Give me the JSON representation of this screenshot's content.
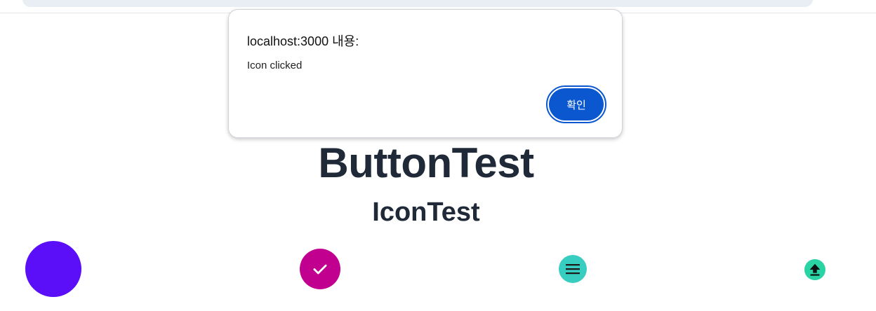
{
  "page": {
    "title": "ButtonTest",
    "subtitle": "IconTest"
  },
  "icons": [
    {
      "name": "plain-circle",
      "color": "#5b0ff9"
    },
    {
      "name": "check-icon",
      "color": "#c2008f"
    },
    {
      "name": "menu-icon",
      "color": "#37cdc1"
    },
    {
      "name": "upload-icon",
      "color": "#2ad3a3"
    }
  ],
  "dialog": {
    "title": "localhost:3000 내용:",
    "message": "Icon clicked",
    "ok_label": "확인",
    "accent": "#0b57d0"
  }
}
